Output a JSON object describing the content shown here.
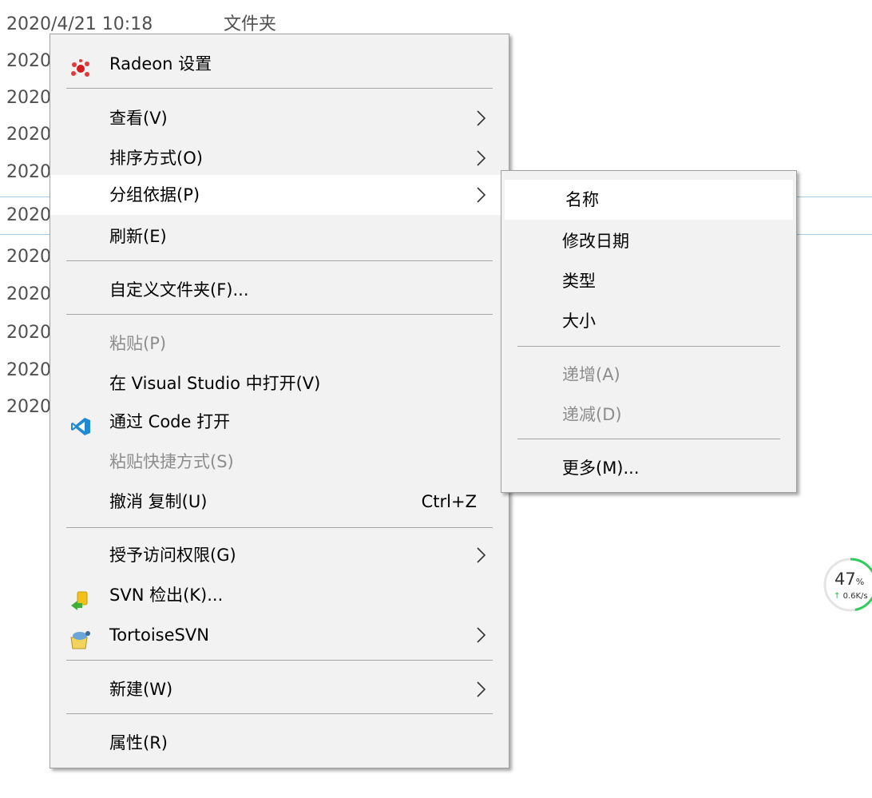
{
  "explorer": {
    "rows": [
      {
        "date": "2020/4/21 10:18",
        "type": "文件夹"
      },
      {
        "date": "2020",
        "type": ""
      },
      {
        "date": "2020",
        "type": ""
      },
      {
        "date": "2020",
        "type": ""
      },
      {
        "date": "2020",
        "type": ""
      },
      {
        "date": "2020",
        "type": ""
      },
      {
        "date": "2020",
        "type": ""
      },
      {
        "date": "2020",
        "type": ""
      },
      {
        "date": "2020",
        "type": ""
      },
      {
        "date": "2020",
        "type": ""
      },
      {
        "date": "2020",
        "type": ""
      }
    ]
  },
  "context_menu": {
    "items": [
      {
        "label": "Radeon 设置",
        "icon": "radeon-icon"
      },
      {
        "label": "查看(V)",
        "submenu": true
      },
      {
        "label": "排序方式(O)",
        "submenu": true
      },
      {
        "label": "分组依据(P)",
        "submenu": true,
        "hover": true
      },
      {
        "label": "刷新(E)"
      },
      {
        "label": "自定义文件夹(F)..."
      },
      {
        "label": "粘贴(P)",
        "disabled": true
      },
      {
        "label": "在 Visual Studio 中打开(V)"
      },
      {
        "label": "通过 Code 打开",
        "icon": "vscode-icon"
      },
      {
        "label": "粘贴快捷方式(S)",
        "disabled": true
      },
      {
        "label": "撤消 复制(U)",
        "shortcut": "Ctrl+Z"
      },
      {
        "label": "授予访问权限(G)",
        "submenu": true
      },
      {
        "label": "SVN 检出(K)...",
        "icon": "svn-checkout-icon"
      },
      {
        "label": "TortoiseSVN",
        "submenu": true,
        "icon": "tortoisesvn-icon"
      },
      {
        "label": "新建(W)",
        "submenu": true
      },
      {
        "label": "属性(R)"
      }
    ]
  },
  "group_by_submenu": {
    "items": [
      {
        "label": "名称",
        "hover": true
      },
      {
        "label": "修改日期"
      },
      {
        "label": "类型"
      },
      {
        "label": "大小"
      },
      {
        "label": "递增(A)",
        "disabled": true
      },
      {
        "label": "递减(D)",
        "disabled": true
      },
      {
        "label": "更多(M)..."
      }
    ]
  },
  "network_widget": {
    "percent": "47",
    "percent_unit": "%",
    "speed": "0.6K/s",
    "speed_arrow": "↑"
  },
  "colors": {
    "menu_bg": "#f2f2f2",
    "hover_bg": "#ffffff",
    "disabled_text": "#8d8d8d",
    "widget_ring": "#2ecc5a"
  }
}
